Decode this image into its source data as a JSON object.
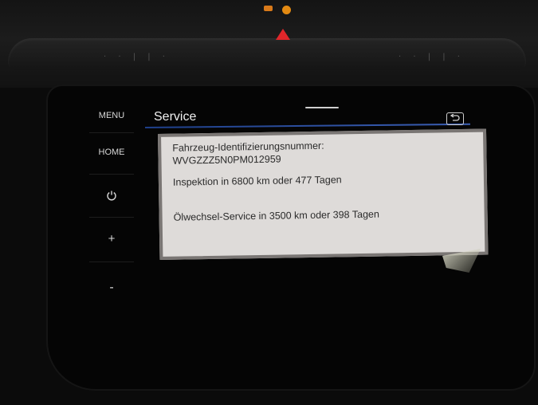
{
  "sidebar": {
    "menu_label": "MENU",
    "home_label": "HOME",
    "power_icon": "power-icon",
    "plus_label": "+",
    "minus_label": "-"
  },
  "header": {
    "title": "Service",
    "back_icon": "back-arrow-icon",
    "accent_color": "#2b4fa8"
  },
  "dialog": {
    "vin_label": "Fahrzeug-Identifizierungsnummer:",
    "vin_value": "WVGZZZ5N0PM012959",
    "inspection": "Inspektion in 6800 km oder 477 Tagen",
    "oil_service": "Ölwechsel-Service in 3500 km oder 398 Tagen"
  },
  "indicators": {
    "hazard_icon": "hazard-warning-icon",
    "hazard_color": "#e0262a",
    "warning_lamp_color": "#e38a12"
  }
}
